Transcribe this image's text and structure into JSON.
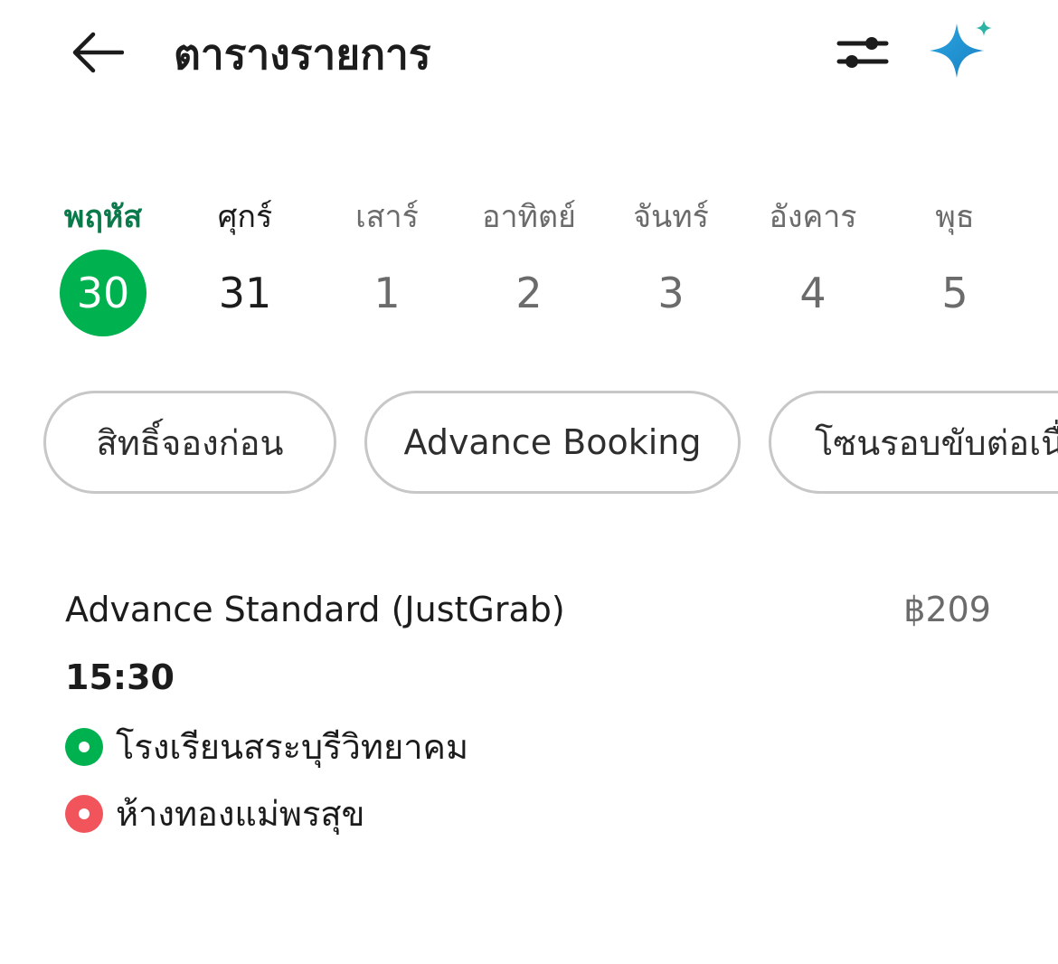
{
  "header": {
    "title": "ตารางรายการ"
  },
  "dates": [
    {
      "day": "พฤหัส",
      "num": "30",
      "selected": true
    },
    {
      "day": "ศุกร์",
      "num": "31"
    },
    {
      "day": "เสาร์",
      "num": "1"
    },
    {
      "day": "อาทิตย์",
      "num": "2"
    },
    {
      "day": "จันทร์",
      "num": "3"
    },
    {
      "day": "อังคาร",
      "num": "4"
    },
    {
      "day": "พุธ",
      "num": "5"
    }
  ],
  "chips": [
    {
      "label": "สิทธิ์จองก่อน"
    },
    {
      "label": "Advance Booking"
    },
    {
      "label": "โซนรอบขับต่อเนื่"
    }
  ],
  "trip": {
    "name": "Advance Standard (JustGrab)",
    "price": "฿209",
    "time": "15:30",
    "pickup": "โรงเรียนสระบุรีวิทยาคม",
    "dropoff": "ห้างทองแม่พรสุข"
  },
  "colors": {
    "accent": "#00b14f",
    "accent_text": "#0b7a4b",
    "pickup": "#00b14f",
    "dropoff": "#f2545b"
  }
}
